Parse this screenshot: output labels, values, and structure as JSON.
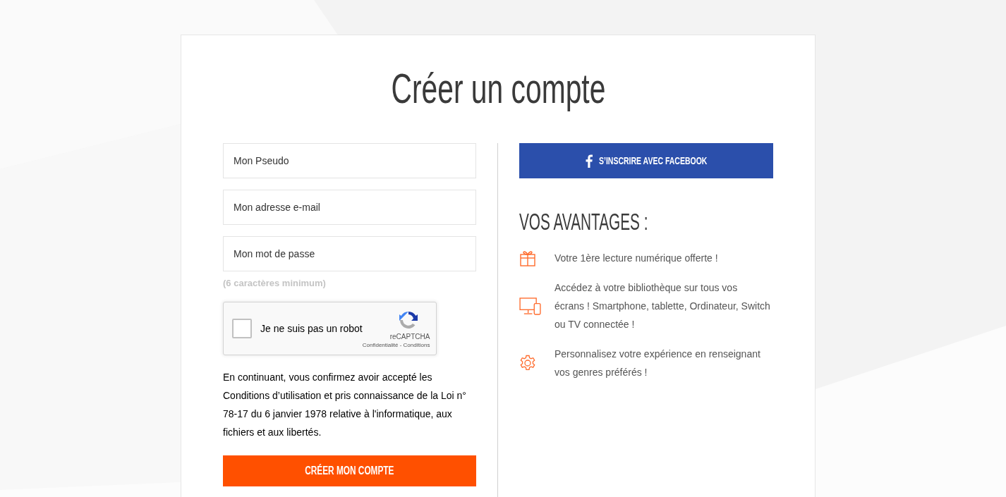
{
  "title": "Créer un compte",
  "form": {
    "fields": [
      {
        "placeholder": "Mon Pseudo"
      },
      {
        "placeholder": "Mon adresse e-mail"
      },
      {
        "placeholder": "Mon mot de passe"
      }
    ],
    "password_hint": "(6 caractères minimum)",
    "captcha": {
      "label": "Je ne suis pas un robot",
      "checked": false,
      "brand": "reCAPTCHA",
      "links": "Confidentialité - Conditions"
    },
    "legal_text": "En continuant, vous confirmez avoir accepté les Conditions d’utilisation et pris connaissance de la Loi n° 78-17 du 6 janvier 1978 relative à l'informatique, aux fichiers et aux libertés.",
    "submit_button": "CRÉER MON COMPTE"
  },
  "social": {
    "facebook_button": "S’INSCRIRE AVEC FACEBOOK"
  },
  "advantages": {
    "heading": "VOS AVANTAGES :",
    "items": [
      {
        "kind": "gift",
        "text": "Votre 1ère lecture numérique offerte !"
      },
      {
        "kind": "devices",
        "text": "Accédez à votre bibliothèque sur tous vos écrans ! Smartphone, tablette, Ordinateur, Switch ou TV connectée !"
      },
      {
        "kind": "gear",
        "text": "Personnalisez votre expérience en renseignant vos genres préférés !"
      }
    ]
  }
}
